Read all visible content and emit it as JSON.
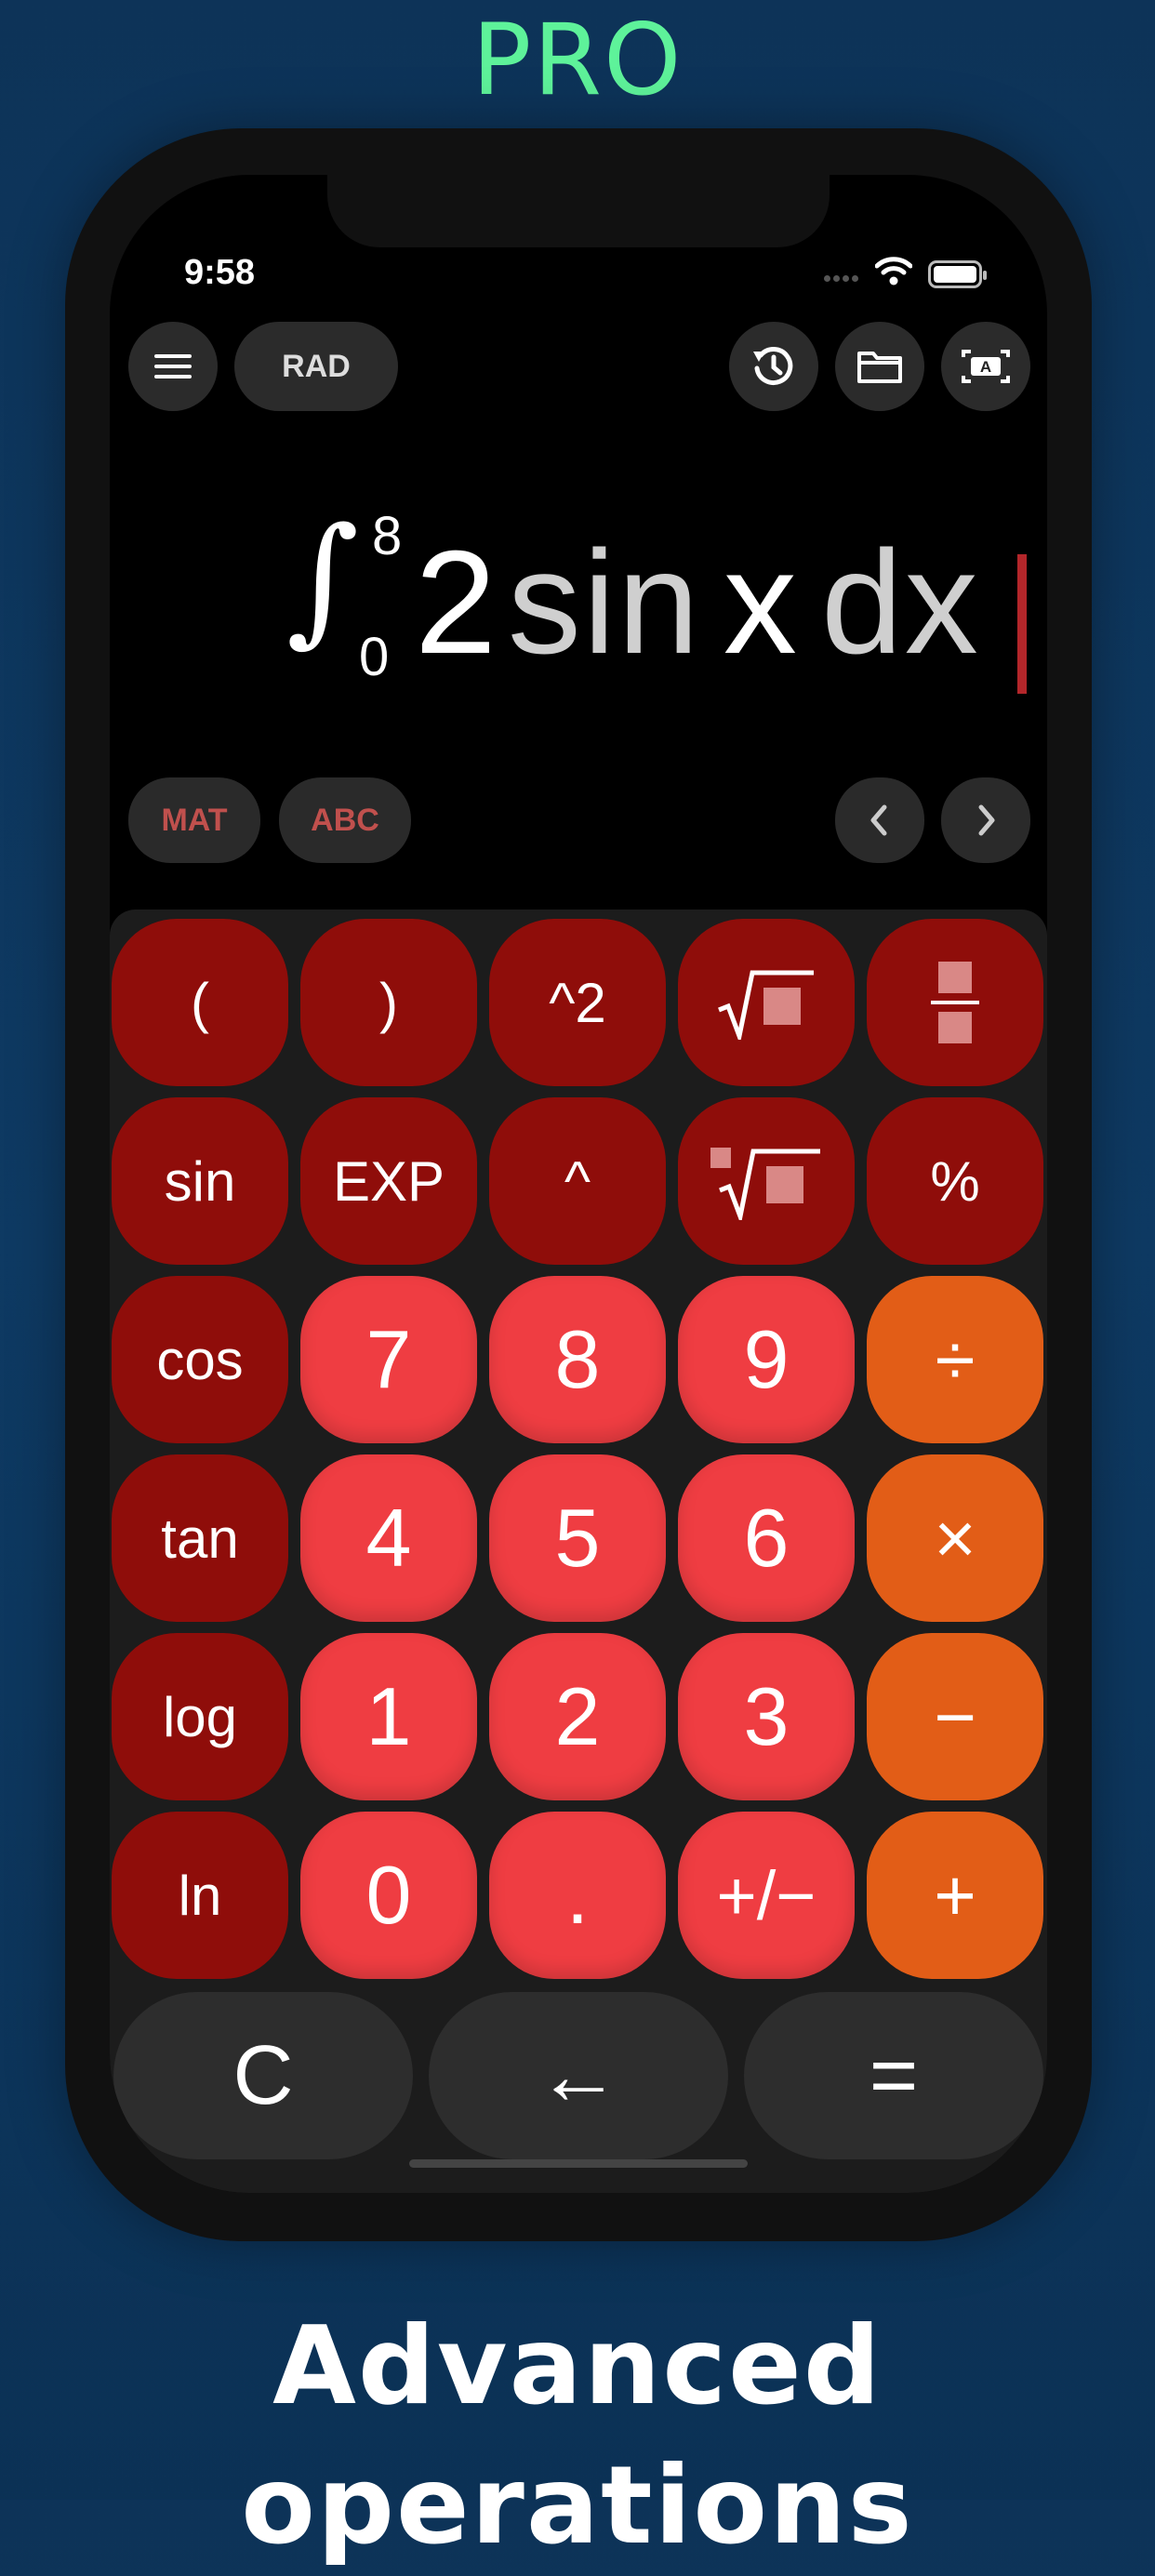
{
  "banner": {
    "text": "PRO",
    "color": "#5ef29a"
  },
  "status_bar": {
    "time": "9:58"
  },
  "toolbar": {
    "menu_icon": "hamburger-menu-icon",
    "angle_mode": "RAD",
    "history_icon": "history-icon",
    "folder_icon": "folder-icon",
    "keyboard_icon": "text-mode-icon"
  },
  "display": {
    "integral_sign": "∫",
    "upper_limit": "8",
    "lower_limit": "0",
    "coefficient": "2",
    "function_name": "sin",
    "variable": "x",
    "differential": "dx",
    "cursor_color": "#b3262a"
  },
  "mode_bar": {
    "mat": "MAT",
    "abc": "ABC",
    "left_icon": "chevron-left-icon",
    "right_icon": "chevron-right-icon"
  },
  "keys": {
    "row1": [
      "(",
      ")",
      "^2",
      "sqrt-icon",
      "fraction-icon"
    ],
    "row2": [
      "sin",
      "EXP",
      "^",
      "nth-root-icon",
      "%"
    ],
    "row3": [
      "cos",
      "7",
      "8",
      "9",
      "÷"
    ],
    "row4": [
      "tan",
      "4",
      "5",
      "6",
      "×"
    ],
    "row5": [
      "log",
      "1",
      "2",
      "3",
      "−"
    ],
    "row6": [
      "ln",
      "0",
      ".",
      "+/−",
      "+"
    ],
    "bottom": [
      "C",
      "←",
      "="
    ]
  },
  "colors": {
    "function_key": "#8f0d0a",
    "digit_key": "#ef3d42",
    "operator_key": "#e25d17",
    "keypad_bg": "#1c1c1c"
  },
  "footer": {
    "text": "Advanced operations"
  }
}
